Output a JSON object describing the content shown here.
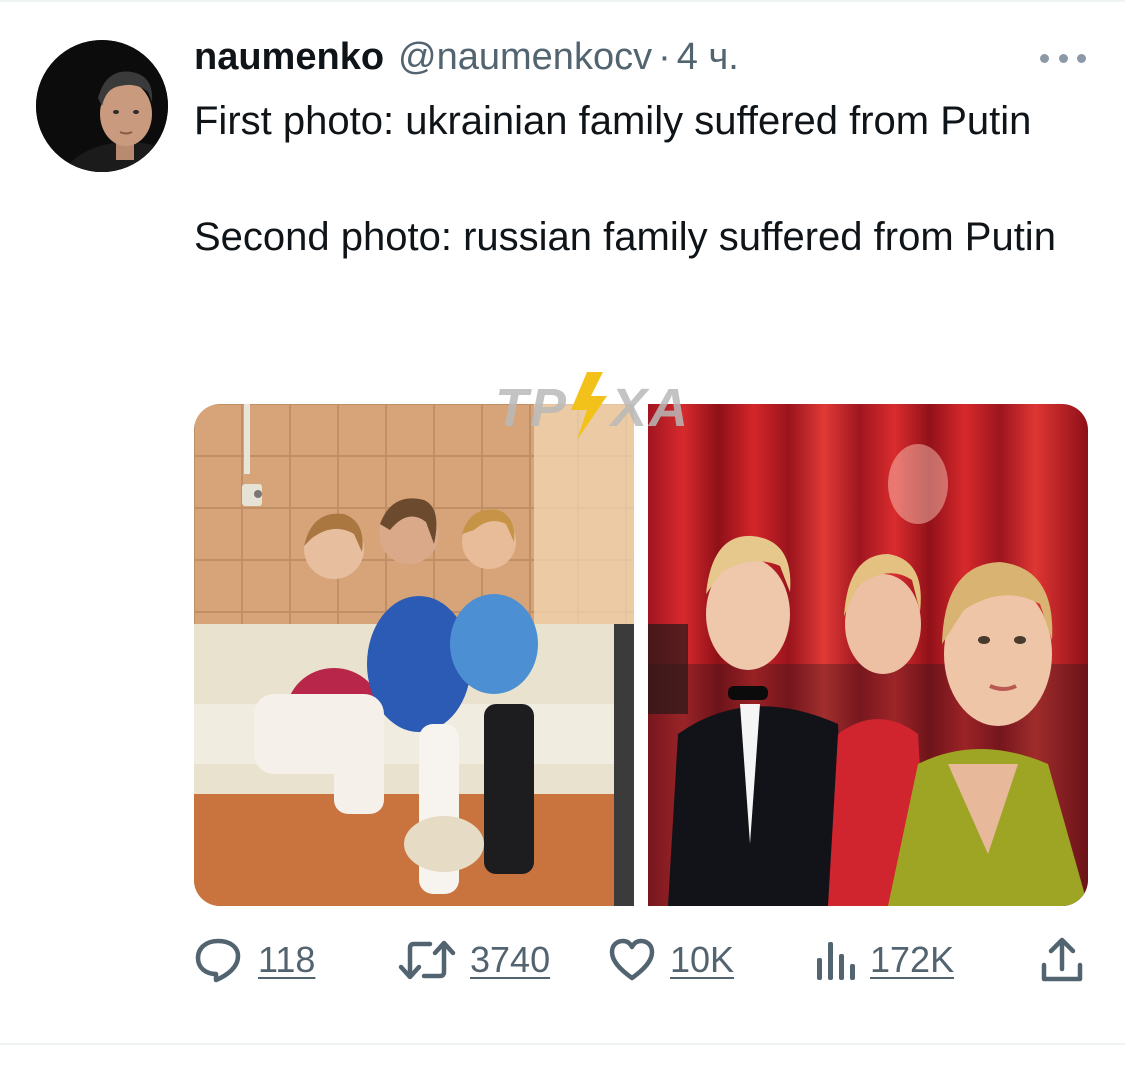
{
  "tweet": {
    "author": {
      "display_name": "naumenko",
      "handle": "@naumenkocv",
      "separator": "·",
      "timestamp": "4 ч."
    },
    "text_paragraphs": [
      "First photo: ukrainian family suffered from Putin",
      "Second photo: russian family suffered from Putin"
    ],
    "watermark": "ТРУХА",
    "actions": {
      "replies": "118",
      "retweets": "3740",
      "likes": "10K",
      "views": "172K"
    },
    "icons": {
      "avatar": "avatar",
      "more": "more-horizontal-icon",
      "reply": "reply-icon",
      "retweet": "retweet-icon",
      "like": "heart-icon",
      "views": "views-icon",
      "share": "share-icon"
    },
    "colors": {
      "text": "#0f1419",
      "secondary": "#536471",
      "divider": "#eff3f4"
    }
  }
}
